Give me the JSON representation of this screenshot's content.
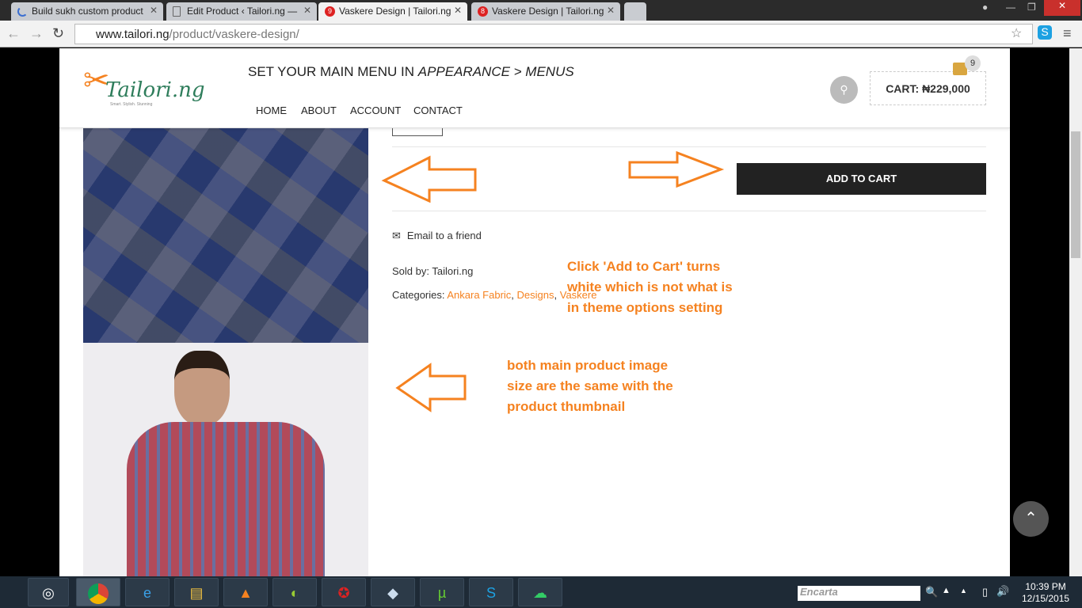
{
  "browser": {
    "tabs": [
      {
        "title": "Build sukh custom product"
      },
      {
        "title": "Edit Product ‹ Tailori.ng —"
      },
      {
        "title": "Vaskere Design | Tailori.ng",
        "badge": "9"
      },
      {
        "title": "Vaskere Design | Tailori.ng",
        "badge": "8"
      }
    ],
    "url_host": "www.tailori.ng",
    "url_path": "/product/vaskere-design/"
  },
  "site": {
    "logo": "Tailori.ng",
    "tagline": "Smart. Stylish. Stunning",
    "notice": "SET YOUR MAIN MENU IN ",
    "notice_em": "APPEARANCE > MENUS",
    "menu": [
      "HOME",
      "ABOUT",
      "ACCOUNT",
      "CONTACT"
    ],
    "cart_label": "CART: ₦229,000",
    "cart_count": "9"
  },
  "product": {
    "add_to_cart": "ADD TO CART",
    "email_friend": "Email to a friend",
    "sold_by": "Sold by: Tailori.ng",
    "categories_label": "Categories: ",
    "categories": [
      "Ankara Fabric",
      "Designs",
      "Vaskere"
    ]
  },
  "annotations": {
    "note1": "Click 'Add to Cart' turns white which is not what is in theme options setting",
    "note2": "both main product image size are the same with the product thumbnail"
  },
  "taskbar": {
    "search": "Encarta",
    "time": "10:39 PM",
    "date": "12/15/2015"
  },
  "colors": {
    "accent": "#f58220",
    "button": "#222222"
  }
}
